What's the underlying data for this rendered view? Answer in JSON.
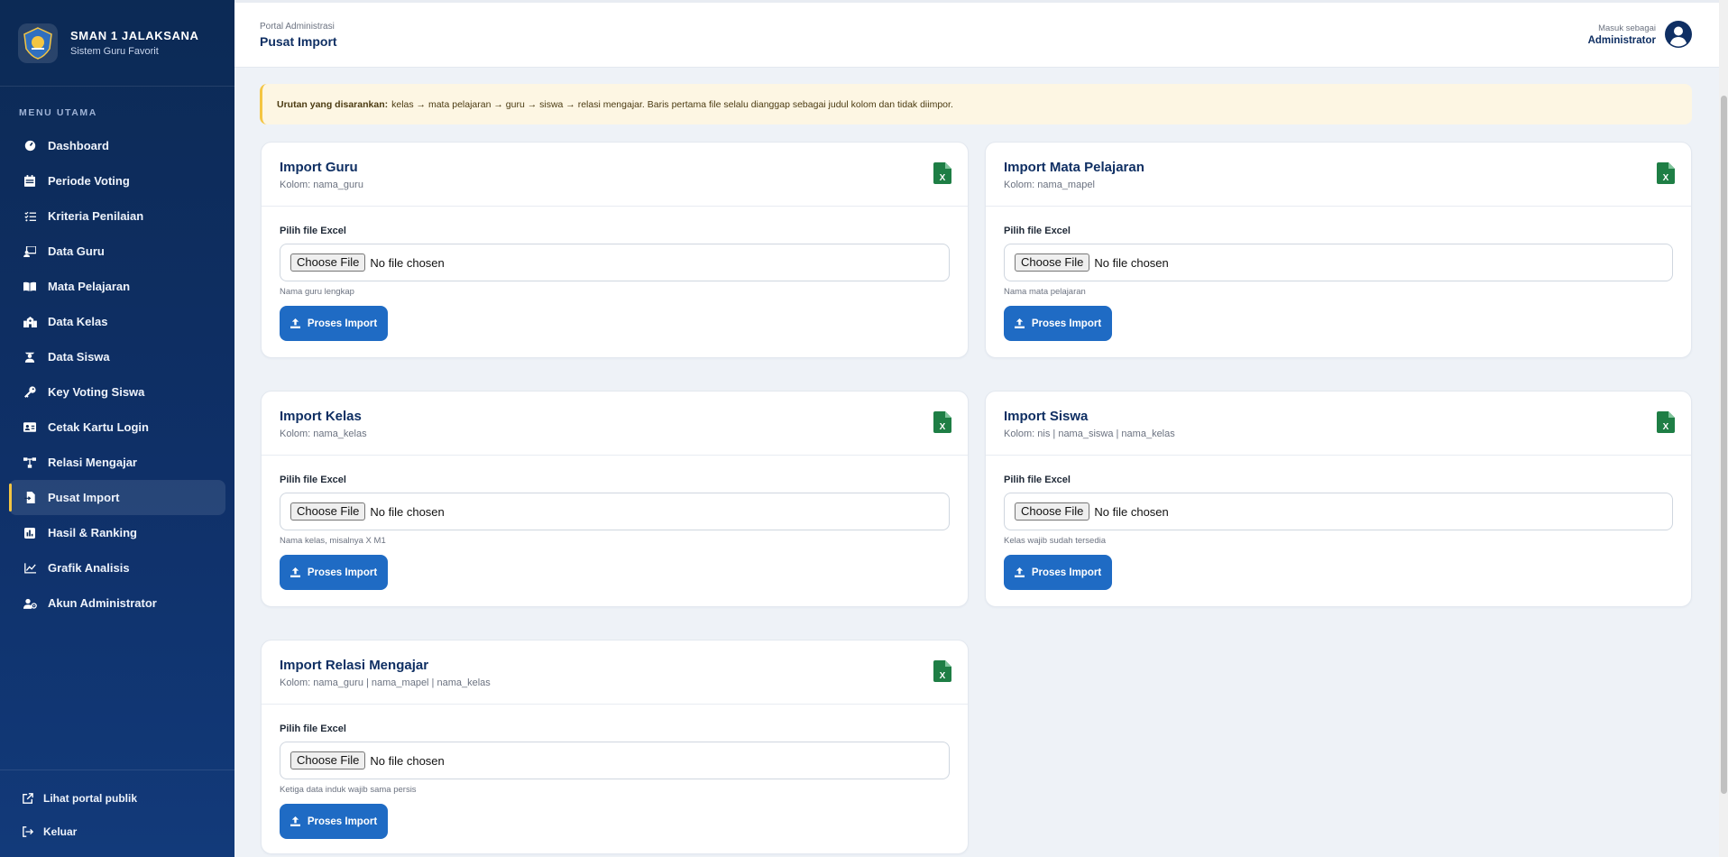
{
  "brand": {
    "title": "SMAN 1 JALAKSANA",
    "subtitle": "Sistem Guru Favorit"
  },
  "menu_heading": "MENU UTAMA",
  "menu": [
    {
      "label": "Dashboard",
      "icon": "gauge-icon"
    },
    {
      "label": "Periode Voting",
      "icon": "calendar-icon"
    },
    {
      "label": "Kriteria Penilaian",
      "icon": "list-check-icon"
    },
    {
      "label": "Data Guru",
      "icon": "teacher-icon"
    },
    {
      "label": "Mata Pelajaran",
      "icon": "book-open-icon"
    },
    {
      "label": "Data Kelas",
      "icon": "school-icon"
    },
    {
      "label": "Data Siswa",
      "icon": "student-icon"
    },
    {
      "label": "Key Voting Siswa",
      "icon": "key-icon"
    },
    {
      "label": "Cetak Kartu Login",
      "icon": "id-card-icon"
    },
    {
      "label": "Relasi Mengajar",
      "icon": "sitemap-icon"
    },
    {
      "label": "Pusat Import",
      "icon": "file-import-icon",
      "active": true
    },
    {
      "label": "Hasil & Ranking",
      "icon": "square-poll-icon"
    },
    {
      "label": "Grafik Analisis",
      "icon": "chart-line-icon"
    },
    {
      "label": "Akun Administrator",
      "icon": "user-gear-icon"
    }
  ],
  "footer": {
    "public_portal": "Lihat portal publik",
    "logout": "Keluar"
  },
  "topbar": {
    "breadcrumb": "Portal Administrasi",
    "title": "Pusat Import",
    "user_label": "Masuk sebagai",
    "user_name": "Administrator"
  },
  "notice": {
    "strong": "Urutan yang disarankan:",
    "text": "kelas → mata pelajaran → guru → siswa → relasi mengajar. Baris pertama file selalu dianggap sebagai judul kolom dan tidak diimpor."
  },
  "common": {
    "field_label": "Pilih file Excel",
    "choose_button": "Choose File",
    "no_file": "No file chosen",
    "submit": "Proses Import"
  },
  "cards": [
    {
      "title": "Import Guru",
      "columns": "Kolom: nama_guru",
      "hint": "Nama guru lengkap"
    },
    {
      "title": "Import Mata Pelajaran",
      "columns": "Kolom: nama_mapel",
      "hint": "Nama mata pelajaran"
    },
    {
      "title": "Import Kelas",
      "columns": "Kolom: nama_kelas",
      "hint": "Nama kelas, misalnya X M1"
    },
    {
      "title": "Import Siswa",
      "columns": "Kolom: nis | nama_siswa | nama_kelas",
      "hint": "Kelas wajib sudah tersedia"
    },
    {
      "title": "Import Relasi Mengajar",
      "columns": "Kolom: nama_guru | nama_mapel | nama_kelas",
      "hint": "Ketiga data induk wajib sama persis"
    }
  ],
  "colors": {
    "sidebar": "#0c2a55",
    "accent": "#1f6bc4",
    "active_marker": "#f4c542",
    "excel_green": "#1e7e45",
    "notice_bg": "#fdf6e3"
  }
}
